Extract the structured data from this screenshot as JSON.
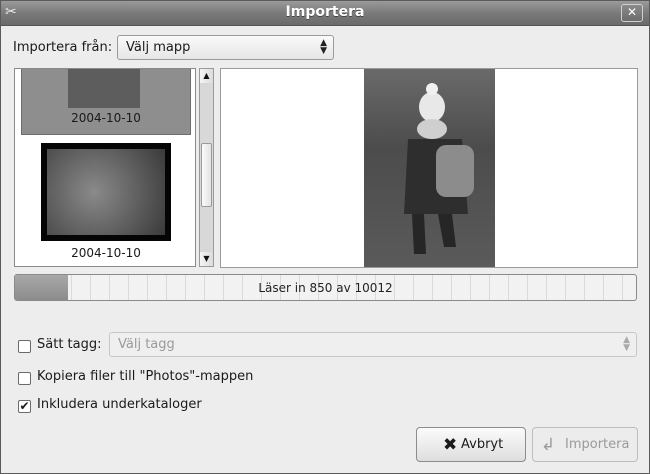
{
  "window": {
    "title": "Importera"
  },
  "source": {
    "label": "Importera från:",
    "selected": "Välj mapp"
  },
  "thumbnails": [
    {
      "date": "2004-10-10",
      "selected": true
    },
    {
      "date": "2004-10-10",
      "selected": false
    }
  ],
  "progress": {
    "text": "Läser in 850 av 10012",
    "fraction": 0.085
  },
  "options": {
    "tag": {
      "label": "Sätt tagg:",
      "placeholder": "Välj tagg",
      "checked": false
    },
    "copy": {
      "label": "Kopiera filer till \"Photos\"-mappen",
      "checked": false
    },
    "subdirs": {
      "label": "Inkludera underkataloger",
      "checked": true
    }
  },
  "buttons": {
    "cancel": "Avbryt",
    "import": "Importera"
  },
  "icons": {
    "app": "camera-icon",
    "close": "close-icon",
    "cancel": "cancel-x-icon",
    "import": "import-arrow-icon"
  }
}
